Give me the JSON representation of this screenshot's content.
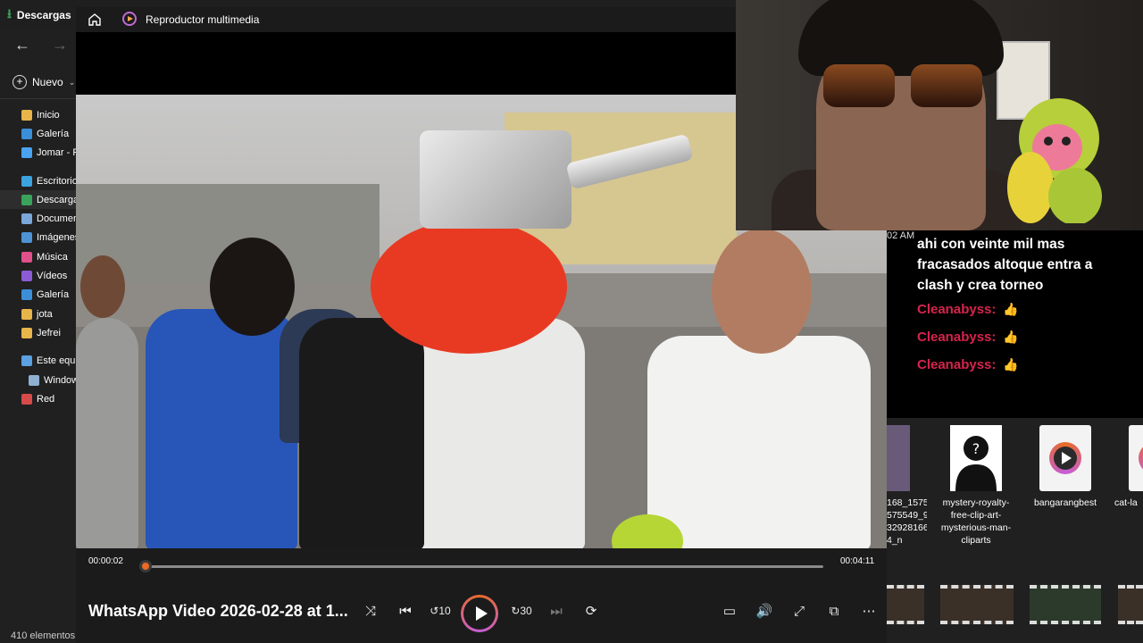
{
  "explorer": {
    "tab_label": "Descargas",
    "new_label": "Nuevo",
    "sidebar": [
      {
        "label": "Inicio",
        "icon": "home-icon",
        "color": "#e8b54a"
      },
      {
        "label": "Galería",
        "icon": "gallery-icon",
        "color": "#3b8fd9"
      },
      {
        "label": "Jomar - P",
        "icon": "onedrive-icon",
        "color": "#4aa3f0"
      },
      {
        "label": "Escritorio",
        "icon": "desktop-icon",
        "color": "#3ba3e0"
      },
      {
        "label": "Descargas",
        "icon": "download-icon",
        "color": "#3aa35b"
      },
      {
        "label": "Documen",
        "icon": "documents-icon",
        "color": "#7aa7d8"
      },
      {
        "label": "Imágenes",
        "icon": "pictures-icon",
        "color": "#4d93d6"
      },
      {
        "label": "Música",
        "icon": "music-icon",
        "color": "#e0508a"
      },
      {
        "label": "Vídeos",
        "icon": "videos-icon",
        "color": "#8b5bd6"
      },
      {
        "label": "Galería",
        "icon": "gallery-icon",
        "color": "#3b8fd9"
      },
      {
        "label": "jota",
        "icon": "folder-icon",
        "color": "#e8b54a"
      },
      {
        "label": "Jefrei",
        "icon": "folder-icon",
        "color": "#e8b54a"
      },
      {
        "label": "Este equi",
        "icon": "this-pc-icon",
        "color": "#5ba0e0"
      },
      {
        "label": "Window",
        "icon": "drive-icon",
        "color": "#8fb0d0"
      },
      {
        "label": "Red",
        "icon": "network-icon",
        "color": "#d84a4a"
      }
    ],
    "status": "410 elementos"
  },
  "player": {
    "app_title": "Reproductor multimedia",
    "video_title": "WhatsApp Video 2026-02-28 at 1...",
    "current_time": "00:00:02",
    "total_time": "00:04:11",
    "progress": 0.008,
    "accent": "#e86b27"
  },
  "chat": {
    "timestamp": "02 AM",
    "message": "ahi con veinte mil mas fracasados altoque entra a clash y crea torneo",
    "lines": [
      {
        "user": "Cleanabyss:",
        "emoji": "👍"
      },
      {
        "user": "Cleanabyss:",
        "emoji": "👍"
      },
      {
        "user": "Cleanabyss:",
        "emoji": "👍"
      }
    ]
  },
  "files": [
    {
      "name": "168_1575 575549_9 32928166 4_n"
    },
    {
      "name": "mystery-royalty-free-clip-art-mysterious-man-cliparts"
    },
    {
      "name": "bangarangbest"
    },
    {
      "name": "cat-la"
    }
  ]
}
